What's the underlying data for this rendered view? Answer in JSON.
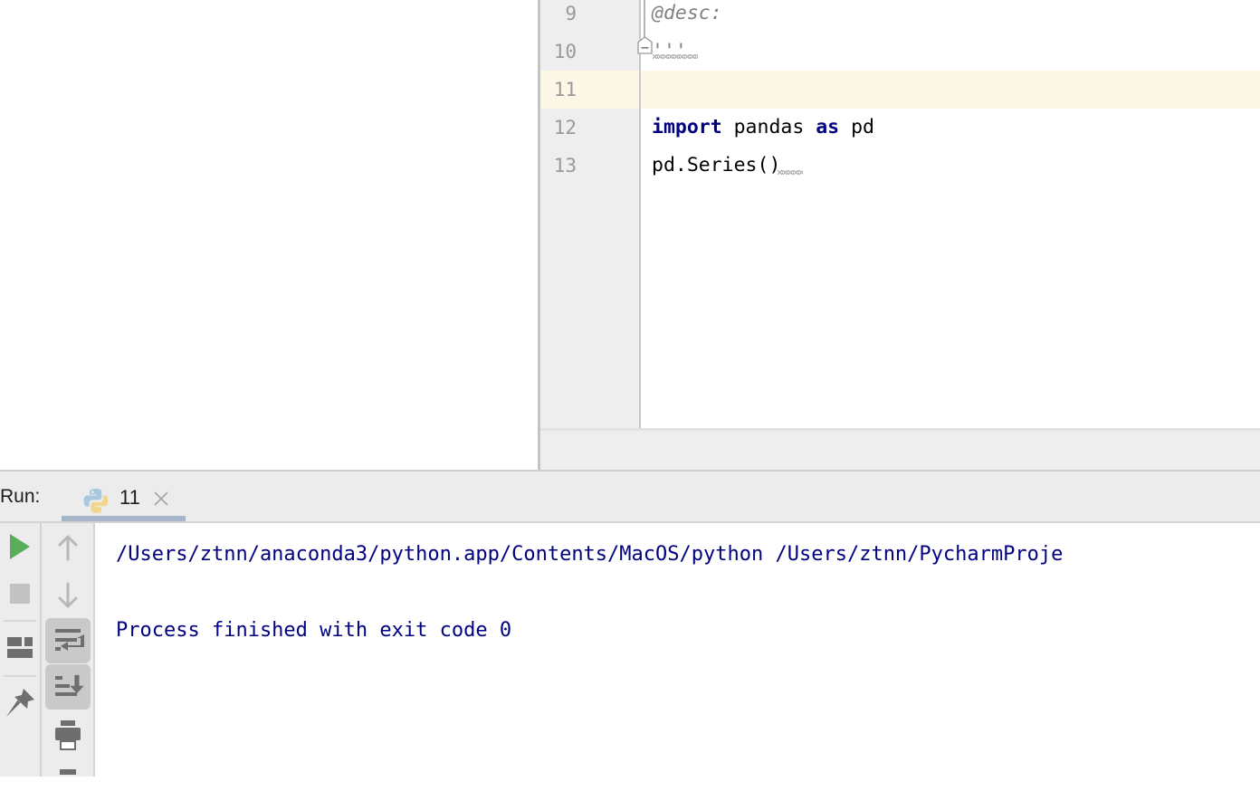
{
  "editor": {
    "lines": [
      {
        "number": "9",
        "tokens": [
          {
            "text": "    @desc:",
            "style": "doc"
          }
        ]
      },
      {
        "number": "10",
        "tokens": [
          {
            "text": "    '''",
            "style": "doc"
          }
        ]
      },
      {
        "number": "11",
        "tokens": [
          {
            "text": "",
            "style": "plain"
          }
        ]
      },
      {
        "number": "12",
        "tokens": [
          {
            "text": "import",
            "style": "kw"
          },
          {
            "text": " pandas ",
            "style": "plain"
          },
          {
            "text": "as",
            "style": "kw"
          },
          {
            "text": " pd",
            "style": "plain"
          }
        ]
      },
      {
        "number": "13",
        "tokens": [
          {
            "text": "pd.Series()",
            "style": "plain"
          }
        ]
      }
    ],
    "line9_text": "@desc:",
    "line10_text": "'''",
    "line11_text": "",
    "line12_kw1": "import",
    "line12_mid": " pandas ",
    "line12_kw2": "as",
    "line12_end": " pd",
    "line13_text": "pd.Series()",
    "line_numbers": {
      "n9": "9",
      "n10": "10",
      "n11": "11",
      "n12": "12",
      "n13": "13"
    },
    "caret_line": "11",
    "fold_marker_icon": "fold-collapse-icon",
    "colors": {
      "keyword": "#000080",
      "docstring": "#808080",
      "text": "#000000",
      "caret_row_background": "#fcf8e5",
      "gutter_background": "#eeeeee"
    }
  },
  "run_panel": {
    "label": "Run:",
    "tab": {
      "icon": "python-logo-icon",
      "name": "11",
      "close_icon": "close-icon",
      "active": true,
      "underline_color": "#a7b5c9"
    },
    "toolbar_left": [
      {
        "icon": "rerun-play-icon",
        "title": "Rerun",
        "color": "#59ad5d",
        "active": false
      },
      {
        "icon": "stop-square-icon",
        "title": "Stop",
        "color": "#c0c0c0",
        "active": false
      },
      {
        "icon": "layout-blocks-icon",
        "title": "Layout",
        "color": "#6e6e6e",
        "active": false
      },
      {
        "icon": "pin-icon",
        "title": "Pin Tab",
        "color": "#6e6e6e",
        "active": false
      }
    ],
    "toolbar_right": [
      {
        "icon": "arrow-up-icon",
        "title": "Up the Stack Trace",
        "color": "#b5b5b5",
        "active": false
      },
      {
        "icon": "arrow-down-icon",
        "title": "Down the Stack Trace",
        "color": "#b5b5b5",
        "active": false
      },
      {
        "icon": "soft-wrap-icon",
        "title": "Soft-Wrap",
        "color": "#6e6e6e",
        "active": true
      },
      {
        "icon": "scroll-to-end-icon",
        "title": "Scroll to End",
        "color": "#6e6e6e",
        "active": true
      },
      {
        "icon": "print-icon",
        "title": "Print",
        "color": "#6e6e6e",
        "active": false
      },
      {
        "icon": "clear-all-icon",
        "title": "Clear All",
        "color": "#6e6e6e",
        "active": false
      }
    ],
    "console": {
      "line1": "/Users/ztnn/anaconda3/python.app/Contents/MacOS/python /Users/ztnn/PycharmProje",
      "line2": "Process finished with exit code 0",
      "text_color": "#000080",
      "background": "#ffffff"
    }
  }
}
